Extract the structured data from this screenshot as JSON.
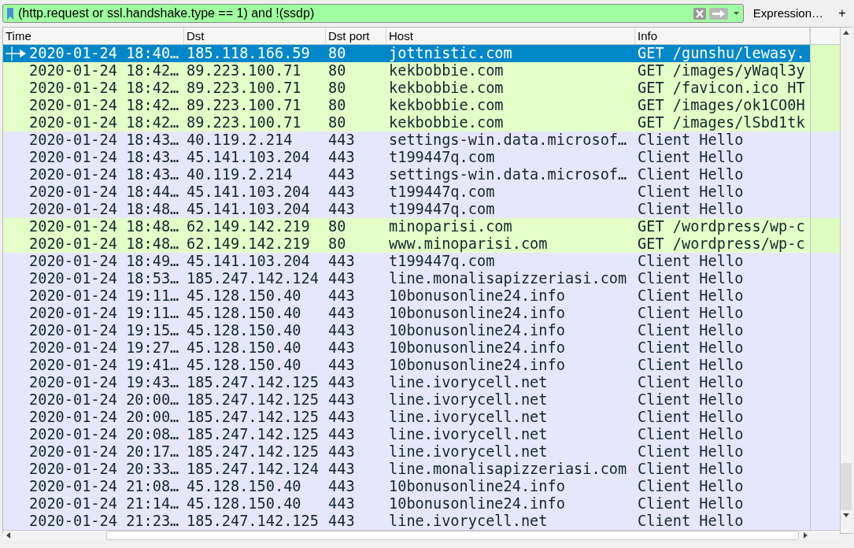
{
  "filter_bar": {
    "value": "(http.request or ssl.handshake.type == 1) and !(ssdp)",
    "expression_button": "Expression…",
    "add_button": "+"
  },
  "table": {
    "columns": [
      "Time",
      "Dst",
      "Dst port",
      "Host",
      "Info"
    ],
    "rows": [
      {
        "kind": "http",
        "selected": true,
        "cells": [
          "2020-01-24 18:40…",
          "185.118.166.59",
          "80",
          "jottnistic.com",
          "GET /gunshu/lewasy."
        ]
      },
      {
        "kind": "http",
        "selected": false,
        "cells": [
          "2020-01-24 18:42…",
          "89.223.100.71",
          "80",
          "kekbobbie.com",
          "GET /images/yWaql3y"
        ]
      },
      {
        "kind": "http",
        "selected": false,
        "cells": [
          "2020-01-24 18:42…",
          "89.223.100.71",
          "80",
          "kekbobbie.com",
          "GET /favicon.ico HT"
        ]
      },
      {
        "kind": "http",
        "selected": false,
        "cells": [
          "2020-01-24 18:42…",
          "89.223.100.71",
          "80",
          "kekbobbie.com",
          "GET /images/ok1CO0H"
        ]
      },
      {
        "kind": "http",
        "selected": false,
        "cells": [
          "2020-01-24 18:42…",
          "89.223.100.71",
          "80",
          "kekbobbie.com",
          "GET /images/lSbd1tk"
        ]
      },
      {
        "kind": "tls",
        "selected": false,
        "cells": [
          "2020-01-24 18:43…",
          "40.119.2.214",
          "443",
          "settings-win.data.microsof…",
          "Client Hello"
        ]
      },
      {
        "kind": "tls",
        "selected": false,
        "cells": [
          "2020-01-24 18:43…",
          "45.141.103.204",
          "443",
          "t199447q.com",
          "Client Hello"
        ]
      },
      {
        "kind": "tls",
        "selected": false,
        "cells": [
          "2020-01-24 18:43…",
          "40.119.2.214",
          "443",
          "settings-win.data.microsof…",
          "Client Hello"
        ]
      },
      {
        "kind": "tls",
        "selected": false,
        "cells": [
          "2020-01-24 18:44…",
          "45.141.103.204",
          "443",
          "t199447q.com",
          "Client Hello"
        ]
      },
      {
        "kind": "tls",
        "selected": false,
        "cells": [
          "2020-01-24 18:48…",
          "45.141.103.204",
          "443",
          "t199447q.com",
          "Client Hello"
        ]
      },
      {
        "kind": "http",
        "selected": false,
        "cells": [
          "2020-01-24 18:48…",
          "62.149.142.219",
          "80",
          "minoparisi.com",
          "GET /wordpress/wp-c"
        ]
      },
      {
        "kind": "http",
        "selected": false,
        "cells": [
          "2020-01-24 18:48…",
          "62.149.142.219",
          "80",
          "www.minoparisi.com",
          "GET /wordpress/wp-c"
        ]
      },
      {
        "kind": "tls",
        "selected": false,
        "cells": [
          "2020-01-24 18:49…",
          "45.141.103.204",
          "443",
          "t199447q.com",
          "Client Hello"
        ]
      },
      {
        "kind": "tls",
        "selected": false,
        "cells": [
          "2020-01-24 18:53…",
          "185.247.142.124",
          "443",
          "line.monalisapizzeriasi.com",
          "Client Hello"
        ]
      },
      {
        "kind": "tls",
        "selected": false,
        "cells": [
          "2020-01-24 19:11…",
          "45.128.150.40",
          "443",
          "10bonusonline24.info",
          "Client Hello"
        ]
      },
      {
        "kind": "tls",
        "selected": false,
        "cells": [
          "2020-01-24 19:11…",
          "45.128.150.40",
          "443",
          "10bonusonline24.info",
          "Client Hello"
        ]
      },
      {
        "kind": "tls",
        "selected": false,
        "cells": [
          "2020-01-24 19:15…",
          "45.128.150.40",
          "443",
          "10bonusonline24.info",
          "Client Hello"
        ]
      },
      {
        "kind": "tls",
        "selected": false,
        "cells": [
          "2020-01-24 19:27…",
          "45.128.150.40",
          "443",
          "10bonusonline24.info",
          "Client Hello"
        ]
      },
      {
        "kind": "tls",
        "selected": false,
        "cells": [
          "2020-01-24 19:41…",
          "45.128.150.40",
          "443",
          "10bonusonline24.info",
          "Client Hello"
        ]
      },
      {
        "kind": "tls",
        "selected": false,
        "cells": [
          "2020-01-24 19:43…",
          "185.247.142.125",
          "443",
          "line.ivorycell.net",
          "Client Hello"
        ]
      },
      {
        "kind": "tls",
        "selected": false,
        "cells": [
          "2020-01-24 20:00…",
          "185.247.142.125",
          "443",
          "line.ivorycell.net",
          "Client Hello"
        ]
      },
      {
        "kind": "tls",
        "selected": false,
        "cells": [
          "2020-01-24 20:00…",
          "185.247.142.125",
          "443",
          "line.ivorycell.net",
          "Client Hello"
        ]
      },
      {
        "kind": "tls",
        "selected": false,
        "cells": [
          "2020-01-24 20:08…",
          "185.247.142.125",
          "443",
          "line.ivorycell.net",
          "Client Hello"
        ]
      },
      {
        "kind": "tls",
        "selected": false,
        "cells": [
          "2020-01-24 20:17…",
          "185.247.142.125",
          "443",
          "line.ivorycell.net",
          "Client Hello"
        ]
      },
      {
        "kind": "tls",
        "selected": false,
        "cells": [
          "2020-01-24 20:33…",
          "185.247.142.124",
          "443",
          "line.monalisapizzeriasi.com",
          "Client Hello"
        ]
      },
      {
        "kind": "tls",
        "selected": false,
        "cells": [
          "2020-01-24 21:08…",
          "45.128.150.40",
          "443",
          "10bonusonline24.info",
          "Client Hello"
        ]
      },
      {
        "kind": "tls",
        "selected": false,
        "cells": [
          "2020-01-24 21:14…",
          "45.128.150.40",
          "443",
          "10bonusonline24.info",
          "Client Hello"
        ]
      },
      {
        "kind": "tls",
        "selected": false,
        "cells": [
          "2020-01-24 21:23…",
          "185.247.142.125",
          "443",
          "line.ivorycell.net",
          "Client Hello"
        ]
      }
    ]
  }
}
